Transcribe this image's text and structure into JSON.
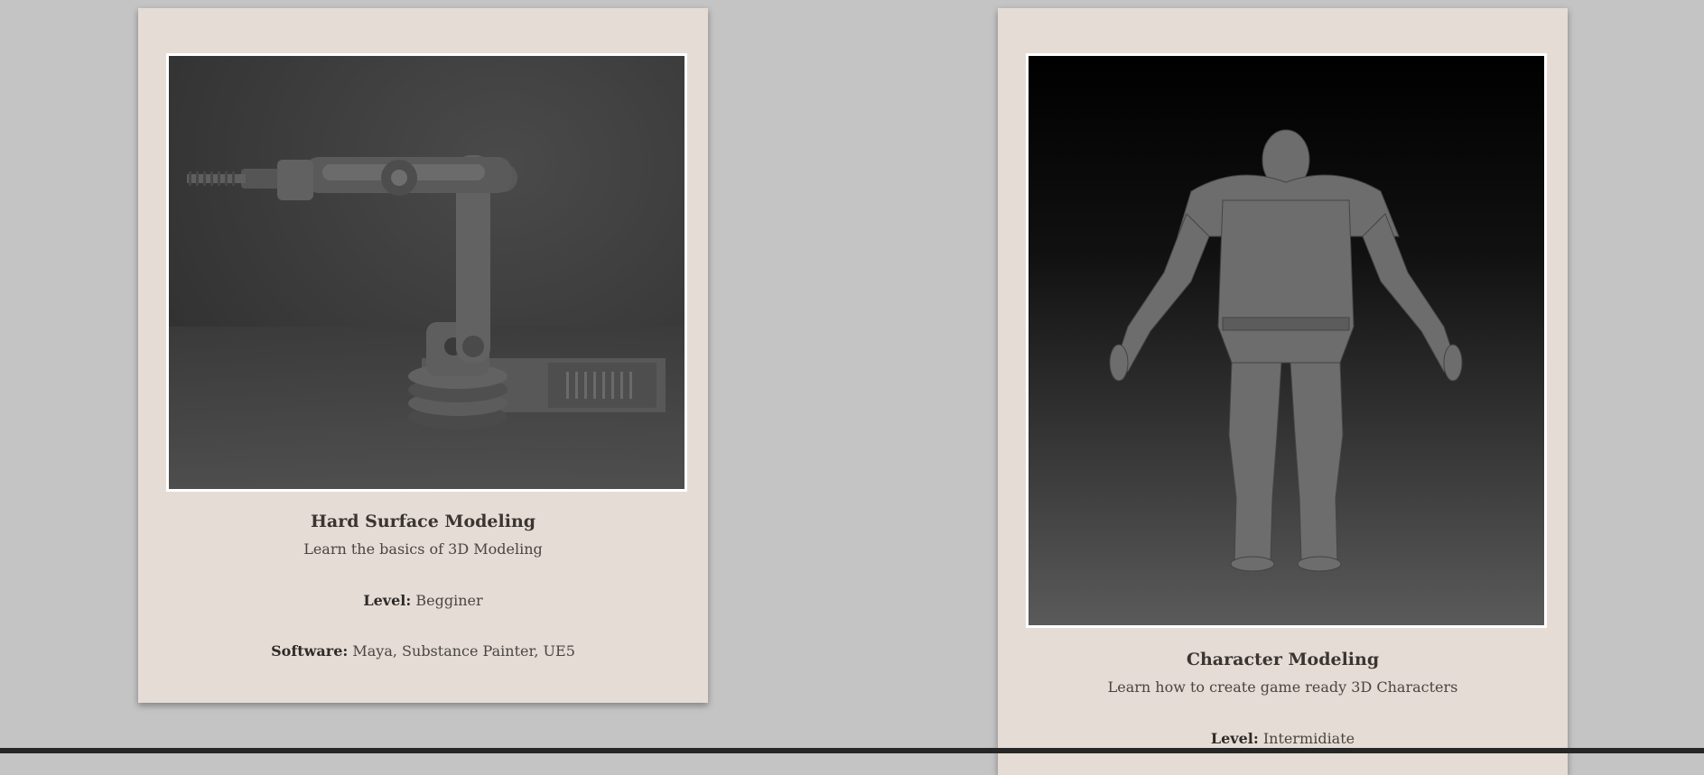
{
  "courses": [
    {
      "title": "Hard Surface Modeling",
      "subtitle": "Learn the basics of 3D Modeling",
      "level_label": "Level:",
      "level_value": "Begginer",
      "software_label": "Software:",
      "software_value": "Maya, Substance Painter, UE5",
      "image_alt": "robotic arm render"
    },
    {
      "title": "Character Modeling",
      "subtitle": "Learn how to create game ready 3D Characters",
      "level_label": "Level:",
      "level_value": "Intermidiate",
      "image_alt": "armored orc character sculpt"
    }
  ]
}
